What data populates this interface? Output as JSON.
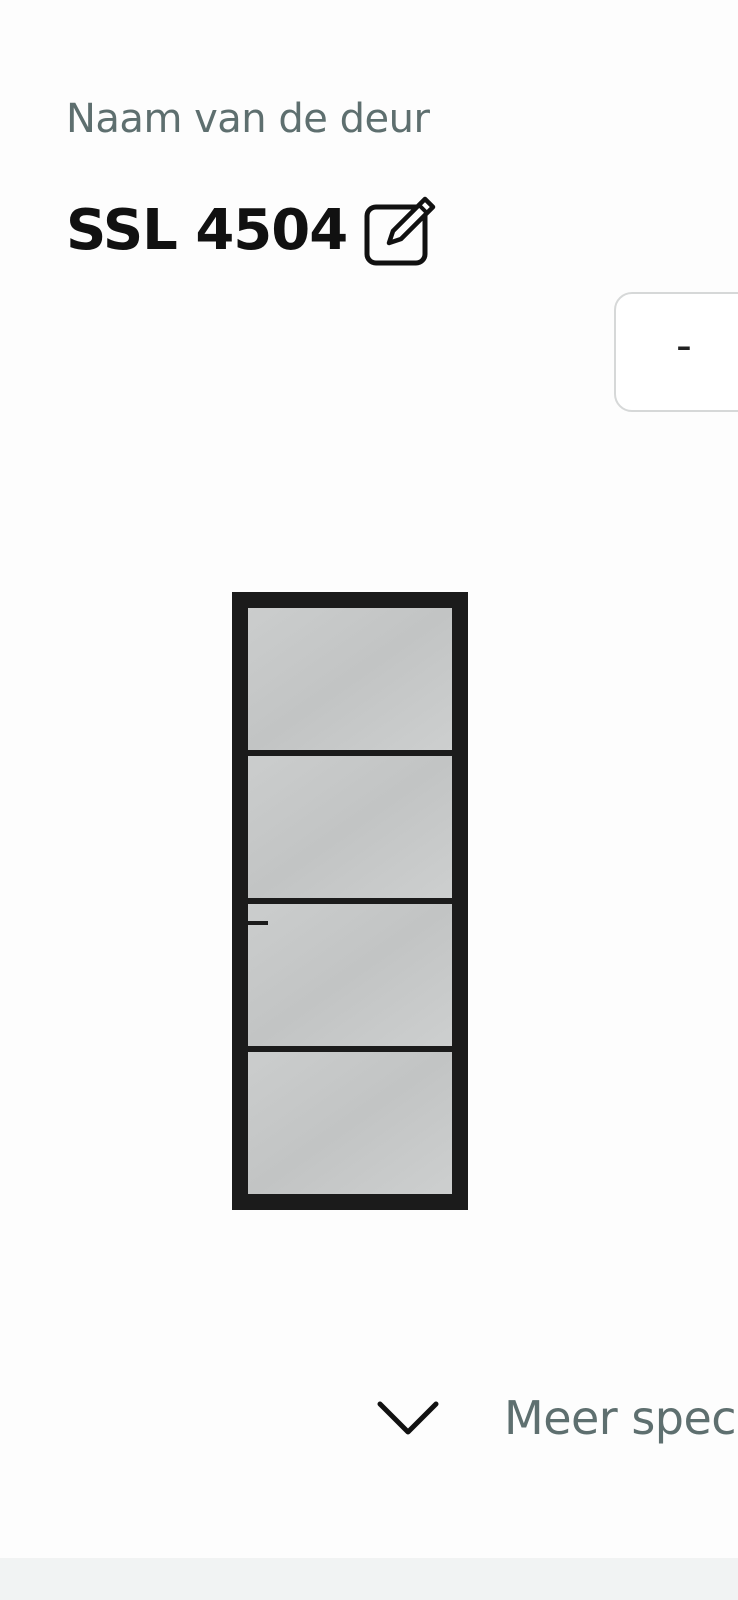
{
  "door": {
    "name_label": "Naam van de deur",
    "title": "SSL 4504"
  },
  "quantity": {
    "decrement_label": "-"
  },
  "icons": {
    "edit": "edit-square-pencil-icon",
    "expand": "chevron-down-icon"
  },
  "specs": {
    "more_label": "Meer specificaties"
  },
  "colors": {
    "label_gray": "#5e6f6f",
    "title_black": "#111111",
    "frame_black": "#1b1b1b",
    "glass_gray": "#c6c8c8"
  }
}
